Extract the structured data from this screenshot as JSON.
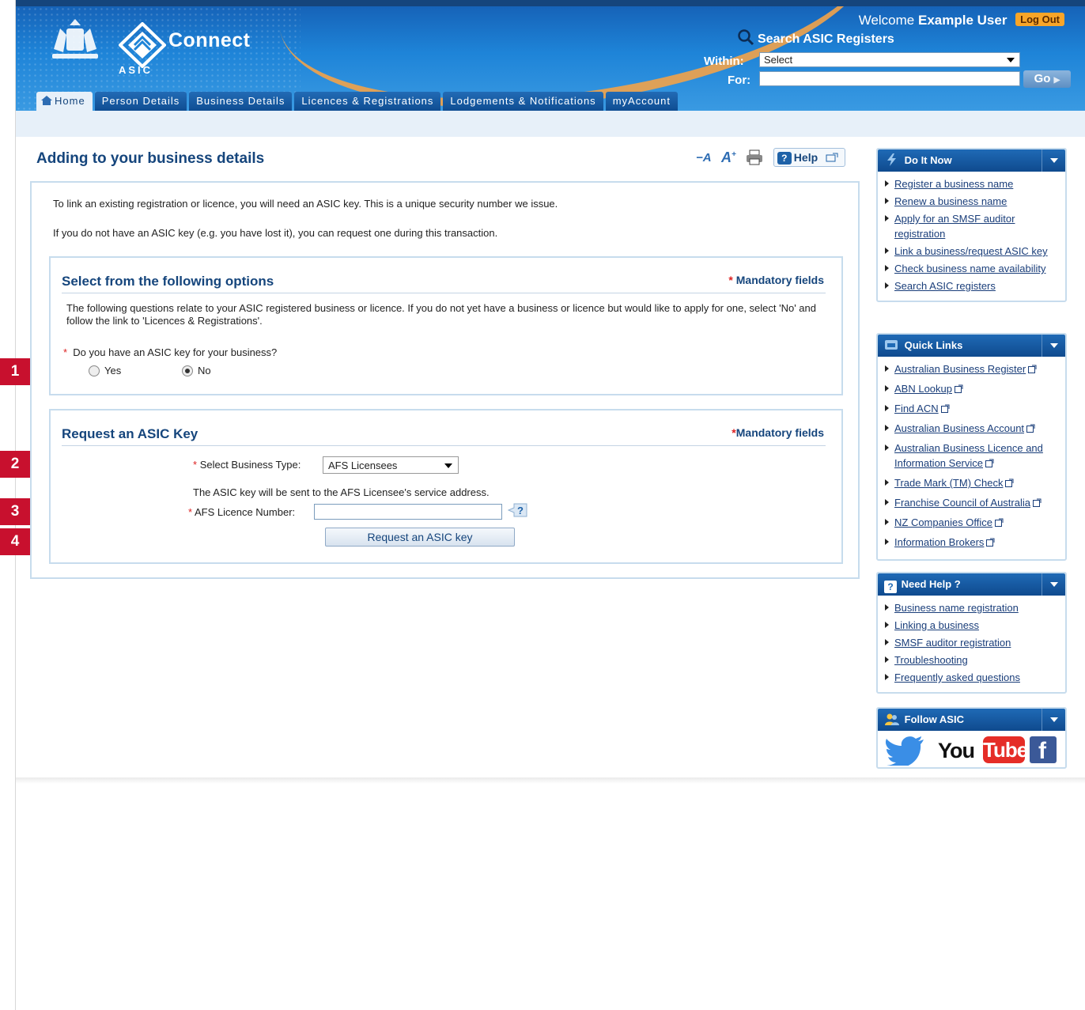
{
  "header": {
    "logo_text": "Connect",
    "asic_text": "ASIC",
    "welcome_prefix": "Welcome",
    "user_name": "Example User",
    "logout_label": "Log Out",
    "search_title": "Search ASIC Registers",
    "within_label": "Within:",
    "within_value": "Select",
    "for_label": "For:",
    "for_value": "",
    "go_label": "Go"
  },
  "tabs": [
    {
      "label": "Home",
      "active": true
    },
    {
      "label": "Person Details"
    },
    {
      "label": "Business Details"
    },
    {
      "label": "Licences & Registrations"
    },
    {
      "label": "Lodgements & Notifications"
    },
    {
      "label": "myAccount"
    }
  ],
  "page": {
    "title": "Adding to your business details",
    "help_label": "Help",
    "intro1": "To link an existing registration or licence, you will need an ASIC key. This is a unique security number we issue.",
    "intro2": "If you do not have an ASIC key (e.g. you have lost it), you can request one during this transaction."
  },
  "options_panel": {
    "title": "Select from the following options",
    "mandatory": "Mandatory fields",
    "description": "The following questions relate to your ASIC registered business or licence. If you do not yet have a business or licence but would like to apply for one, select 'No' and follow the link to 'Licences & Registrations'.",
    "question": "Do you have an ASIC key for your business?",
    "yes_label": "Yes",
    "no_label": "No",
    "selected": "No"
  },
  "request_panel": {
    "title": "Request an ASIC Key",
    "mandatory": "Mandatory fields",
    "business_type_label": "Select Business Type:",
    "business_type_value": "AFS Licensees",
    "service_note": "The ASIC key will be sent to the AFS Licensee's service address.",
    "licence_label": "AFS Licence Number:",
    "licence_value": "",
    "button_label": "Request an ASIC key"
  },
  "steps": [
    "1",
    "2",
    "3",
    "4"
  ],
  "sidebar": {
    "do_it_now": {
      "title": "Do It Now",
      "items": [
        "Register a business name",
        "Renew a business name",
        "Apply for an SMSF auditor registration",
        "Link a business/request ASIC key",
        "Check business name availability",
        "Search ASIC registers"
      ]
    },
    "quick_links": {
      "title": "Quick Links",
      "items": [
        "Australian Business Register",
        "ABN Lookup",
        "Find ACN",
        "Australian Business Account",
        "Australian Business Licence and Information Service",
        "Trade Mark (TM) Check",
        "Franchise Council of Australia",
        "NZ Companies Office",
        "Information Brokers"
      ]
    },
    "need_help": {
      "title": "Need Help ?",
      "items": [
        "Business name registration",
        "Linking a business",
        "SMSF auditor registration",
        "Troubleshooting",
        "Frequently asked questions"
      ]
    },
    "follow": {
      "title": "Follow ASIC",
      "youtube_you": "You",
      "youtube_tube": "Tube",
      "facebook_f": "f"
    }
  },
  "colors": {
    "brand_blue": "#15457c",
    "header_blue": "#1e84d8",
    "accent_orange": "#f8a528",
    "step_red": "#c8102e",
    "panel_border": "#c7dced"
  }
}
